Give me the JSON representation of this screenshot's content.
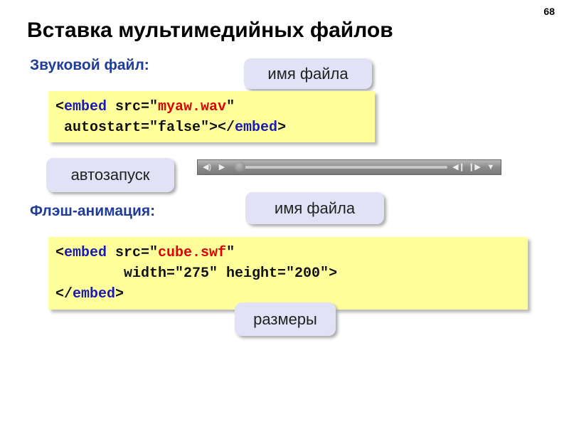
{
  "page_number": "68",
  "title": "Вставка мультимедийных файлов",
  "audio_section": {
    "heading": "Звуковой файл:",
    "code": {
      "lt": "<",
      "tag": "embed",
      "attr_src": " src=\"",
      "src": "myaw.wav",
      "q": "\"",
      "line2_prefix": " autostart=\"false\"></",
      "tag_close": "embed",
      "gt": ">"
    },
    "callout_filename": "имя файла",
    "callout_autostart": "автозапуск"
  },
  "player": {
    "progress": 0
  },
  "flash_section": {
    "heading": "Флэш-анимация:",
    "code": {
      "lt": "<",
      "tag": "embed",
      "attr_src": " src=\"",
      "src": "cube.swf",
      "q": "\"",
      "line2": "        width=\"275\" height=\"200\">",
      "line3_open": "</",
      "tag_close": "embed",
      "gt": ">"
    },
    "callout_filename": "имя файла",
    "callout_sizes": "размеры"
  }
}
